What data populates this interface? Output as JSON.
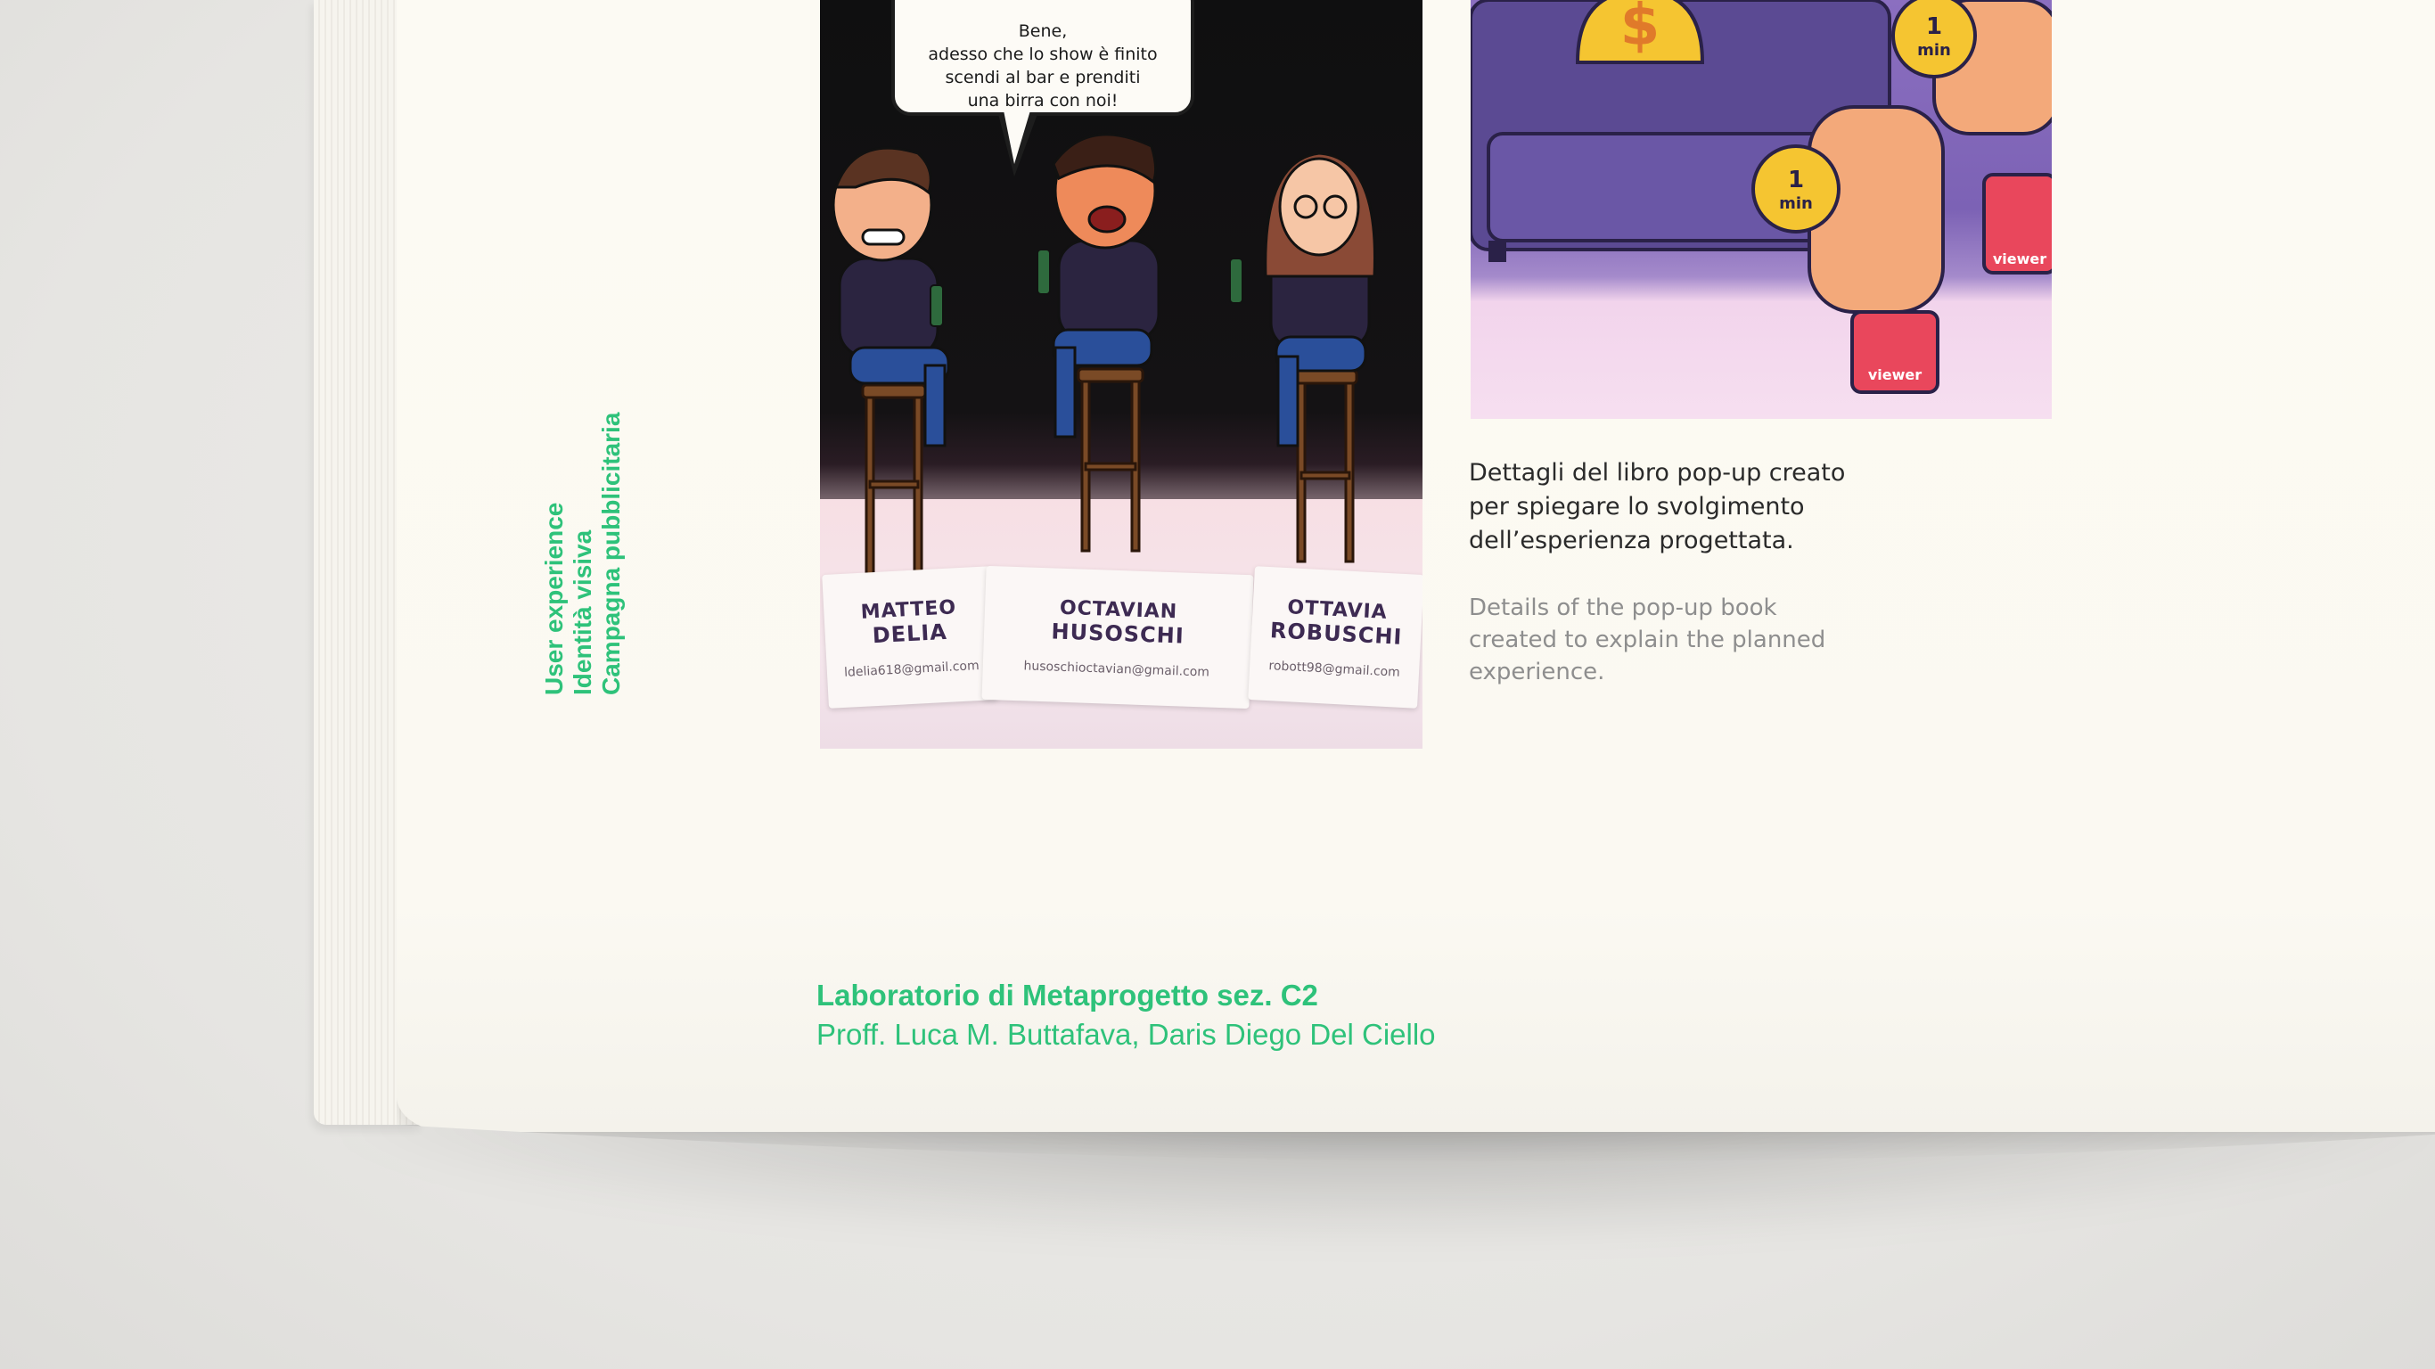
{
  "sidebar_tags": [
    "User experience",
    "Identità visiva",
    "Campagna pubblicitaria"
  ],
  "photo_left": {
    "speech_bubble": [
      "Bene,",
      "adesso che lo show è finito",
      "scendi al bar e prenditi",
      "una birra con noi!"
    ],
    "cards": [
      {
        "first": "MATTEO",
        "last": "DELIA",
        "email": "ldelia618@gmail.com"
      },
      {
        "first": "OCTAVIAN",
        "last": "HUSOSCHI",
        "email": "husoschioctavian@gmail.com"
      },
      {
        "first": "OTTAVIA",
        "last": "ROBUSCHI",
        "email": "robott98@gmail.com"
      }
    ]
  },
  "photo_right": {
    "coin_label_number": "1",
    "coin_label_unit": "min",
    "sleeve_brand": "viewer",
    "dollar_sign": "$"
  },
  "caption": {
    "italian": [
      "Dettagli del libro pop-up creato",
      "per spiegare lo svolgimento",
      "dell’esperienza progettata."
    ],
    "english": [
      "Details of the pop-up book",
      "created to explain the planned",
      "experience."
    ]
  },
  "footer": {
    "course": "Laboratorio di Metaprogetto sez. C2",
    "professors": "Proff. Luca M. Buttafava, Daris Diego Del Ciello"
  },
  "colors": {
    "accent_green": "#2ec27a",
    "page": "#fbf9f2",
    "background": "#e9e8e5"
  }
}
